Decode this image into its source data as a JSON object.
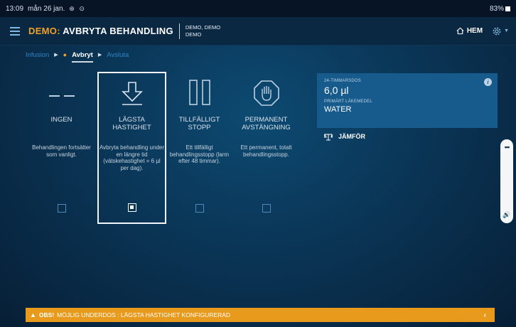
{
  "status_bar": {
    "time": "13:09",
    "date": "mån 26 jan.",
    "battery": "83%"
  },
  "header": {
    "title_prefix": "DEMO:",
    "title_main": " AVBRYTA BEHANDLING",
    "patient_line1": "DEMO, DEMO",
    "patient_line2": "DEMO",
    "home_label": "HEM",
    "settings_icon": "gear-icon"
  },
  "breadcrumb": {
    "step1": "Infusion",
    "step2": "Avbryt",
    "step3": "Avsluta"
  },
  "options": [
    {
      "id": "ingen",
      "name_l1": "INGEN",
      "name_l2": "",
      "desc": "Behandlingen fortsätter som vanligt.",
      "icon": "dash-icon",
      "selected": false
    },
    {
      "id": "lagsta",
      "name_l1": "LÄGSTA",
      "name_l2": "HASTIGHET",
      "desc": "Avbryta behandling under en längre tid (vätskehastighet = 6 µl per dag).",
      "icon": "arrow-down-icon",
      "selected": true
    },
    {
      "id": "tillfalligt",
      "name_l1": "TILLFÄLLIGT",
      "name_l2": "STOPP",
      "desc": "Ett tillfälligt behandlingsstopp (larm efter 48 timmar).",
      "icon": "pause-icon",
      "selected": false
    },
    {
      "id": "permanent",
      "name_l1": "PERMANENT",
      "name_l2": "AVSTÄNGNING",
      "desc": "Ett permanent, totalt behandlingsstopp.",
      "icon": "stop-hand-icon",
      "selected": false
    }
  ],
  "dose_card": {
    "dose_label": "24-TIMMARSDOS",
    "dose_value": "6,0 µl",
    "drug_label": "PRIMÄRT LÄKEMEDEL",
    "drug_value": "WATER"
  },
  "compare_label": "JÄMFÖR",
  "warning": {
    "prefix": "OBS!",
    "text": "MÖJLIG UNDERDOS : LÄGSTA HASTIGHET KONFIGURERAD"
  },
  "colors": {
    "accent_orange": "#f0a12a",
    "card_blue": "#175a8c",
    "warning_bar": "#e89a1c"
  }
}
